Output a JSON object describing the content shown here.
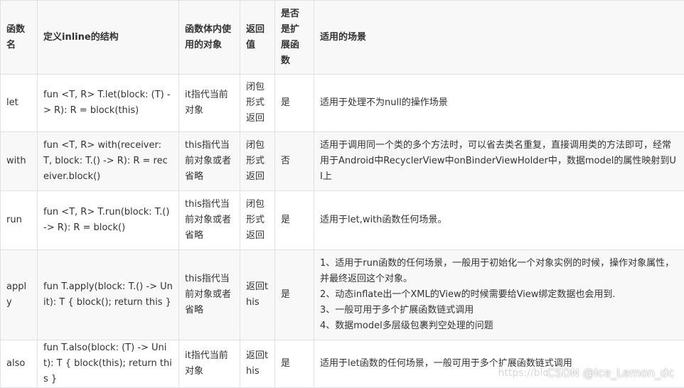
{
  "table": {
    "headers": [
      "函数名",
      "定义inline的结构",
      "函数体内使用的对象",
      "返回值",
      "是否是扩展函数",
      "适用的场景"
    ],
    "rows": [
      {
        "name": "let",
        "definition": "fun <T, R> T.let(block: (T) -> R): R = block(this)",
        "object": "it指代当前对象",
        "return_value": "闭包形式返回",
        "is_extension": "是",
        "scene": [
          "适用于处理不为null的操作场景"
        ]
      },
      {
        "name": "with",
        "definition": "fun <T, R> with(receiver: T, block: T.() -> R): R = receiver.block()",
        "object": "this指代当前对象或者省略",
        "return_value": "闭包形式返回",
        "is_extension": "否",
        "scene": [
          "适用于调用同一个类的多个方法时，可以省去类名重复，直接调用类的方法即可，经常用于Android中RecyclerView中onBinderViewHolder中，数据model的属性映射到UI上"
        ]
      },
      {
        "name": "run",
        "definition": "fun <T, R> T.run(block: T.() -> R): R = block()",
        "object": "this指代当前对象或者省略",
        "return_value": "闭包形式返回",
        "is_extension": "是",
        "scene": [
          "适用于let,with函数任何场景。"
        ]
      },
      {
        "name": "apply",
        "definition": "fun T.apply(block: T.() -> Unit): T { block(); return this }",
        "object": "this指代当前对象或者省略",
        "return_value": "返回this",
        "is_extension": "是",
        "scene": [
          "1、适用于run函数的任何场景，一般用于初始化一个对象实例的时候，操作对象属性，并最终返回这个对象。",
          "2、动态inflate出一个XML的View的时候需要给View绑定数据也会用到.",
          "3、一般可用于多个扩展函数链式调用",
          "4、数据model多层级包裹判空处理的问题"
        ]
      },
      {
        "name": "also",
        "definition": "fun T.also(block: (T) -> Unit): T { block(this); return this }",
        "object": "it指代当前对象",
        "return_value": "返回this",
        "is_extension": "是",
        "scene": [
          "适用于let函数的任何场景，一般可用于多个扩展函数链式调用"
        ]
      }
    ]
  },
  "watermark": "CSDN @Ice_Lemon_dc",
  "watermark_faint": "https://blo"
}
